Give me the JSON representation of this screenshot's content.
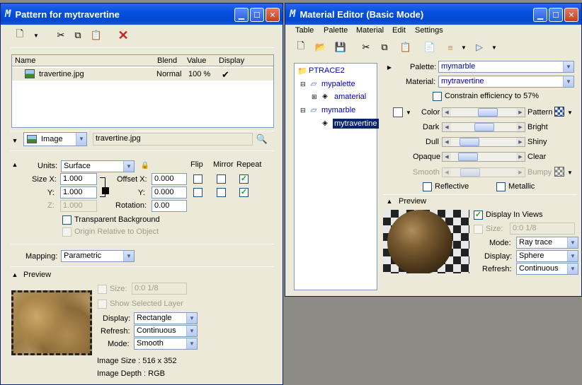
{
  "left": {
    "title": "Pattern for mytravertine",
    "columns": [
      "Name",
      "Blend",
      "Value",
      "Display"
    ],
    "row": {
      "name": "travertine.jpg",
      "blend": "Normal",
      "value": "100 %",
      "display": "✔"
    },
    "image_type": "Image",
    "image_file": "travertine.jpg",
    "units_label": "Units:",
    "units_value": "Surface",
    "flip": "Flip",
    "mirror": "Mirror",
    "repeat": "Repeat",
    "size_x_label": "Size X:",
    "size_x": "1.000",
    "y_label": "Y:",
    "size_y": "1.000",
    "z_label": "Z:",
    "size_z": "1.000",
    "offset_x_label": "Offset X:",
    "offset_x": "0.000",
    "offset_y_label": "Y:",
    "offset_y": "0.000",
    "rotation_label": "Rotation:",
    "rotation": "0.00",
    "transparent_bg": "Transparent Background",
    "origin_relative": "Origin Relative to Object",
    "mapping_label": "Mapping:",
    "mapping_value": "Parametric",
    "preview_label": "Preview",
    "size_label": "Size:",
    "size_value": "0:0 1/8",
    "show_selected": "Show Selected Layer",
    "display_label": "Display:",
    "display_value": "Rectangle",
    "refresh_label": "Refresh:",
    "refresh_value": "Continuous",
    "mode_label": "Mode:",
    "mode_value": "Smooth",
    "image_size": "Image Size : 516 x 352",
    "image_depth": "Image Depth : RGB"
  },
  "right": {
    "title": "Material Editor (Basic Mode)",
    "menu": [
      "Table",
      "Palette",
      "Material",
      "Edit",
      "Settings"
    ],
    "tree": {
      "root": "PTRACE2",
      "palette1": "mypalette",
      "material1": "amaterial",
      "palette2": "mymarble",
      "material2": "mytravertine"
    },
    "palette_label": "Palette:",
    "palette_value": "mymarble",
    "material_label": "Material:",
    "material_value": "mytravertine",
    "constrain": "Constrain efficiency to 57%",
    "color": "Color",
    "pattern": "Pattern",
    "dark": "Dark",
    "bright": "Bright",
    "dull": "Dull",
    "shiny": "Shiny",
    "opaque": "Opaque",
    "clear": "Clear",
    "smooth": "Smooth",
    "bumpy": "Bumpy",
    "reflective": "Reflective",
    "metallic": "Metallic",
    "preview_label": "Preview",
    "display_in_views": "Display In Views",
    "size_label": "Size:",
    "size_value": "0:0 1/8",
    "mode_label": "Mode:",
    "mode_value": "Ray trace",
    "display_label": "Display:",
    "display_value": "Sphere",
    "refresh_label": "Refresh:",
    "refresh_value": "Continuous",
    "sliders": {
      "color": 0.6,
      "dark": 0.52,
      "dull": 0.18,
      "opaque": 0.15,
      "smooth": 0.2
    }
  },
  "colors": {
    "title_bar": "#0551e0",
    "window_bg": "#ece9d8",
    "selection": "#0a246a"
  }
}
